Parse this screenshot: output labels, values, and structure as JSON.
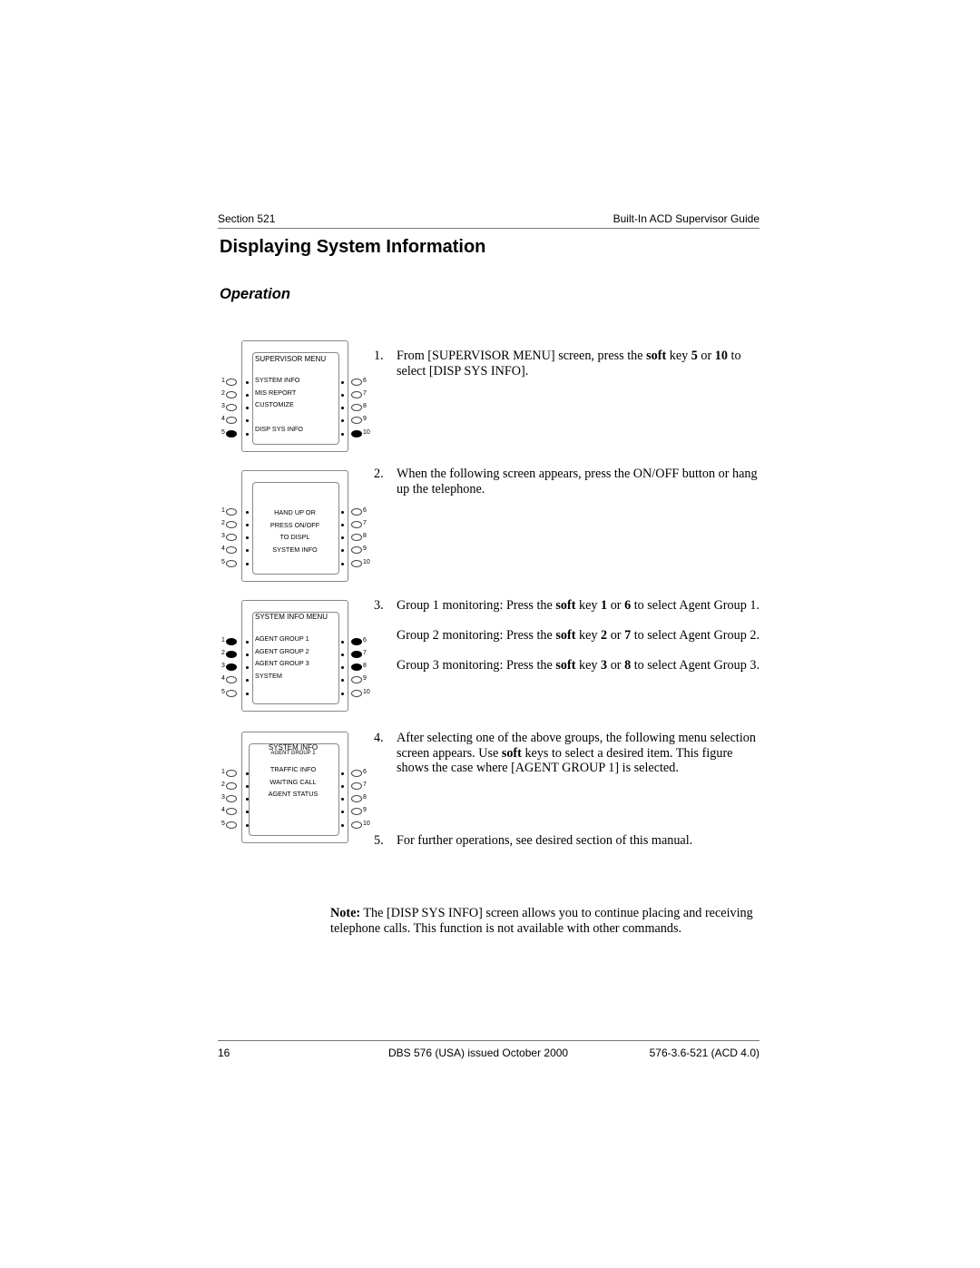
{
  "header": {
    "section": "Section 521",
    "guide": "Built-In ACD Supervisor Guide"
  },
  "title": "Displaying System Information",
  "subtitle": "Operation",
  "diagrams": [
    {
      "header": "SUPERVISOR    MENU",
      "lines": [
        "SYSTEM INFO",
        "MIS REPORT",
        "CUSTOMIZE",
        "",
        "DISP SYS INFO"
      ],
      "active_keys": [
        5,
        10
      ]
    },
    {
      "header": "",
      "lines": [
        "HAND UP OR",
        "PRESS ON/OFF",
        "TO DISPL",
        "SYSTEM INFO"
      ],
      "active_keys": []
    },
    {
      "header": "SYSTEM INFO MENU",
      "lines": [
        "AGENT GROUP 1",
        "AGENT GROUP 2",
        "AGENT GROUP 3",
        "SYSTEM",
        ""
      ],
      "active_keys": [
        1,
        2,
        3,
        6,
        7,
        8
      ]
    },
    {
      "header": "SYSTEM INFO",
      "subheader": "AGENT GROUP 1",
      "lines": [
        "TRAFFIC INFO",
        "WAITING CALL",
        "AGENT STATUS"
      ],
      "active_keys": []
    }
  ],
  "key_labels": {
    "left": [
      "1",
      "2",
      "3",
      "4",
      "5"
    ],
    "right": [
      "6",
      "7",
      "8",
      "9",
      "10"
    ]
  },
  "steps": [
    {
      "num": "1.",
      "parts": [
        [
          "From [SUPERVISOR MENU] screen, press the ",
          false
        ],
        [
          "soft",
          true
        ],
        [
          " key ",
          false
        ],
        [
          "5",
          true
        ],
        [
          " or ",
          false
        ],
        [
          "10",
          true
        ],
        [
          " to select [DISP SYS INFO].",
          false
        ]
      ]
    },
    {
      "num": "2.",
      "parts": [
        [
          "When the following screen appears, press the ON/OFF button or hang up the telephone.",
          false
        ]
      ]
    },
    {
      "num": "3.",
      "parts": [
        [
          "Group 1 monitoring: Press the ",
          false
        ],
        [
          "soft",
          true
        ],
        [
          " key ",
          false
        ],
        [
          "1",
          true
        ],
        [
          " or ",
          false
        ],
        [
          "6",
          true
        ],
        [
          " to select Agent Group 1.",
          false
        ]
      ]
    },
    {
      "num": "",
      "parts": [
        [
          "Group 2 monitoring: Press the ",
          false
        ],
        [
          "soft",
          true
        ],
        [
          " key ",
          false
        ],
        [
          "2",
          true
        ],
        [
          " or ",
          false
        ],
        [
          "7",
          true
        ],
        [
          " to select Agent Group 2.",
          false
        ]
      ]
    },
    {
      "num": "",
      "parts": [
        [
          "Group 3 monitoring: Press the ",
          false
        ],
        [
          "soft",
          true
        ],
        [
          " key ",
          false
        ],
        [
          "3",
          true
        ],
        [
          " or ",
          false
        ],
        [
          "8",
          true
        ],
        [
          " to select Agent Group 3.",
          false
        ]
      ]
    },
    {
      "num": "4.",
      "parts": [
        [
          "After selecting one of the above groups, the following menu selection screen appears. Use ",
          false
        ],
        [
          "soft",
          true
        ],
        [
          " keys to select a desired item. This figure shows the case where [AGENT GROUP 1] is selected.",
          false
        ]
      ]
    },
    {
      "num": "5.",
      "parts": [
        [
          "For further operations, see desired section of this manual.",
          false
        ]
      ]
    }
  ],
  "note": {
    "label": "Note:",
    "text": " The [DISP SYS INFO] screen allows you to continue placing and receiving telephone calls.  This function is not available with other commands."
  },
  "footer": {
    "page": "16",
    "issue": "DBS 576 (USA) issued October 2000",
    "doc_id": "576-3.6-521 (ACD 4.0)"
  }
}
